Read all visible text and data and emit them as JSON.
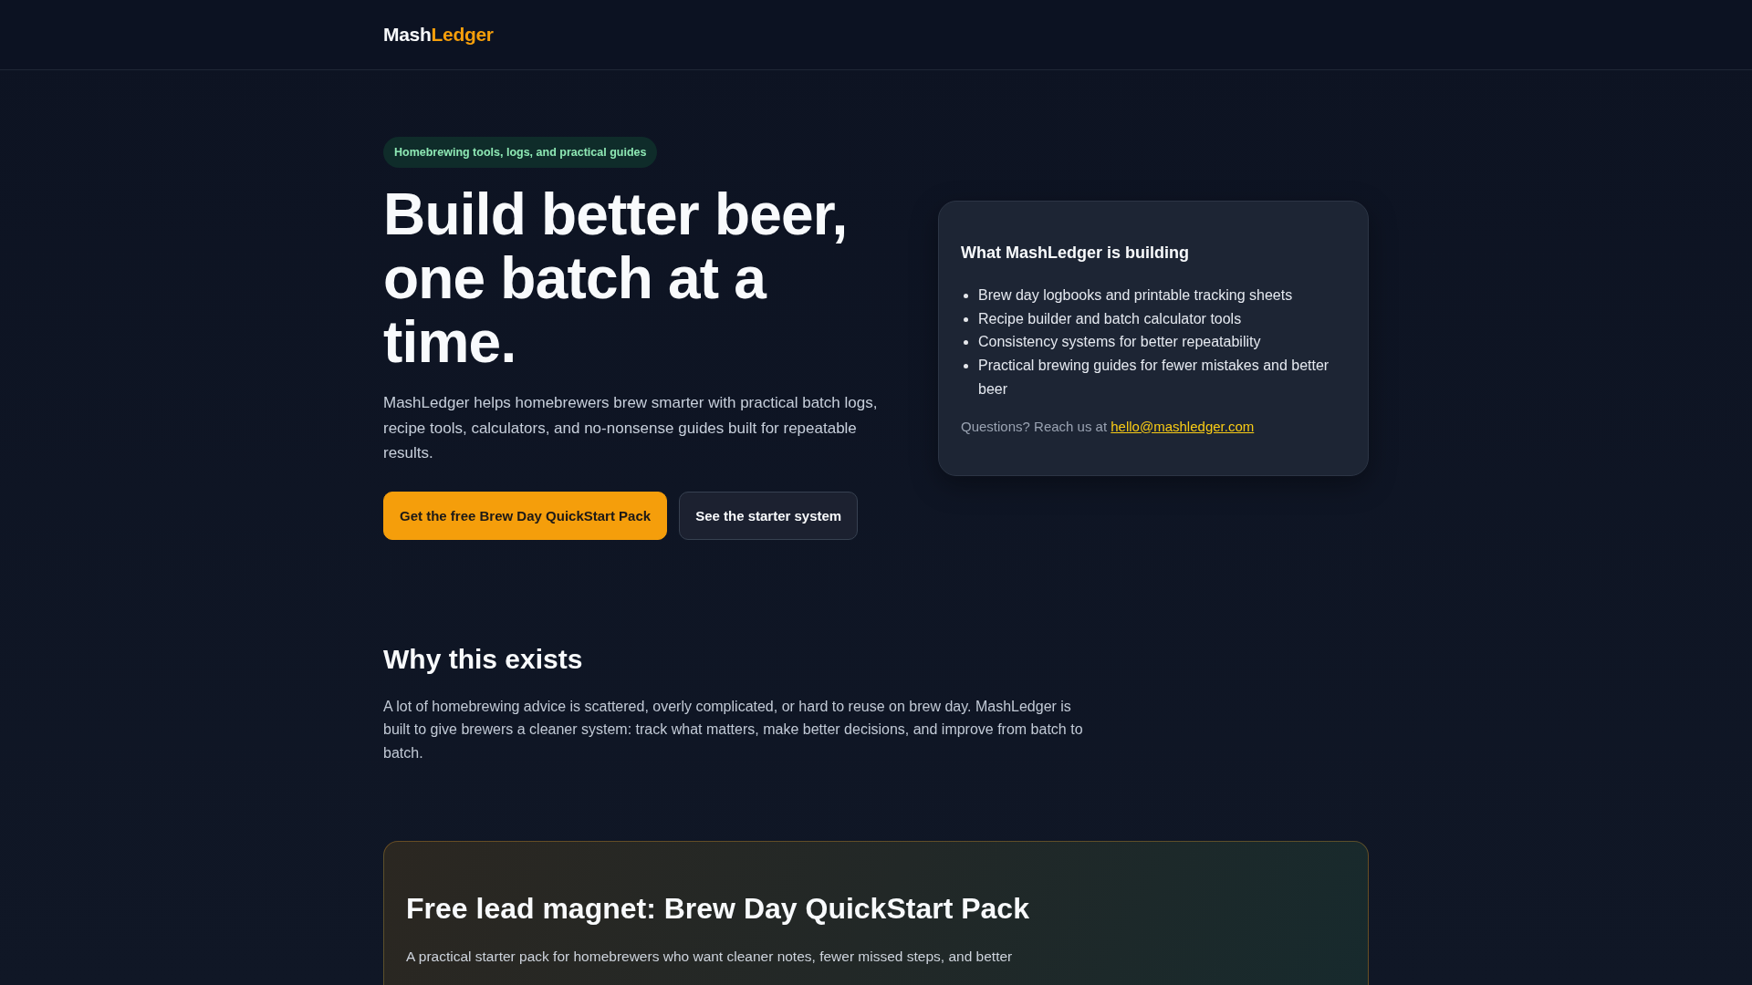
{
  "header": {
    "logo": [
      {
        "text": "Mash",
        "kind": "plain"
      },
      {
        "text": "Ledger",
        "kind": "accent"
      }
    ]
  },
  "hero": {
    "badge": "Homebrewing tools, logs, and practical guides",
    "title": "Build better beer, one batch at a time.",
    "description": "MashLedger helps homebrewers brew smarter with practical batch logs, recipe tools, calculators, and no-nonsense guides built for repeatable results.",
    "buttons": [
      {
        "label": "Get the free Brew Day QuickStart Pack",
        "kind": "primary"
      },
      {
        "label": "See the starter system",
        "kind": "secondary"
      }
    ]
  },
  "info_card": {
    "title": "What MashLedger is building",
    "items": [
      "Brew day logbooks and printable tracking sheets",
      "Recipe builder and batch calculator tools",
      "Consistency systems for better repeatability",
      "Practical brewing guides for fewer mistakes and better beer"
    ],
    "contact": {
      "text": "Questions? Reach us at",
      "link": "hello@mashledger.com"
    }
  },
  "why_section": {
    "title": "Why this exists",
    "body": "A lot of homebrewing advice is scattered, overly complicated, or hard to reuse on brew day. MashLedger is built to give brewers a cleaner system: track what matters, make better decisions, and improve from batch to batch."
  },
  "lead_magnet": {
    "title": "Free lead magnet: Brew Day QuickStart Pack",
    "description": "A practical starter pack for homebrewers who want cleaner notes, fewer missed steps, and better"
  }
}
